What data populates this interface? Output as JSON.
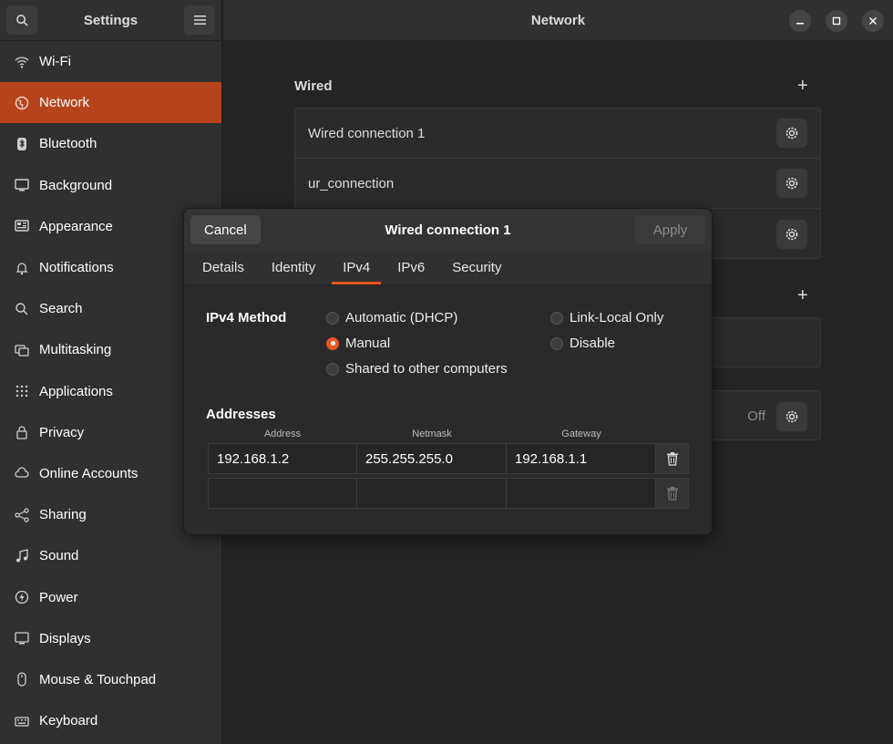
{
  "sidebar": {
    "title": "Settings",
    "items": [
      {
        "label": "Wi-Fi",
        "icon": "wifi-icon"
      },
      {
        "label": "Network",
        "icon": "network-icon",
        "active": true
      },
      {
        "label": "Bluetooth",
        "icon": "bluetooth-icon"
      },
      {
        "label": "Background",
        "icon": "background-icon"
      },
      {
        "label": "Appearance",
        "icon": "appearance-icon"
      },
      {
        "label": "Notifications",
        "icon": "bell-icon"
      },
      {
        "label": "Search",
        "icon": "search-icon"
      },
      {
        "label": "Multitasking",
        "icon": "multitasking-icon"
      },
      {
        "label": "Applications",
        "icon": "grid-icon"
      },
      {
        "label": "Privacy",
        "icon": "lock-icon"
      },
      {
        "label": "Online Accounts",
        "icon": "cloud-icon"
      },
      {
        "label": "Sharing",
        "icon": "share-icon"
      },
      {
        "label": "Sound",
        "icon": "music-note-icon"
      },
      {
        "label": "Power",
        "icon": "power-icon"
      },
      {
        "label": "Displays",
        "icon": "display-icon"
      },
      {
        "label": "Mouse & Touchpad",
        "icon": "mouse-icon"
      },
      {
        "label": "Keyboard",
        "icon": "keyboard-icon"
      }
    ]
  },
  "header": {
    "title": "Network"
  },
  "wired": {
    "title": "Wired",
    "connections": [
      "Wired connection 1",
      "ur_connection",
      ""
    ]
  },
  "vpn_row": {
    "status": "Off"
  },
  "dialog": {
    "title": "Wired connection 1",
    "cancel_label": "Cancel",
    "apply_label": "Apply",
    "tabs": [
      "Details",
      "Identity",
      "IPv4",
      "IPv6",
      "Security"
    ],
    "active_tab": "IPv4",
    "method_label": "IPv4 Method",
    "methods": {
      "auto": "Automatic (DHCP)",
      "manual": "Manual",
      "shared": "Shared to other computers",
      "link_local": "Link-Local Only",
      "disable": "Disable"
    },
    "selected_method": "Manual",
    "addresses_label": "Addresses",
    "columns": {
      "address": "Address",
      "netmask": "Netmask",
      "gateway": "Gateway"
    },
    "rows": [
      {
        "address": "192.168.1.2",
        "netmask": "255.255.255.0",
        "gateway": "192.168.1.1"
      },
      {
        "address": "",
        "netmask": "",
        "gateway": ""
      }
    ]
  },
  "colors": {
    "accent": "#e95420",
    "sidebar_active": "#b5431b",
    "background": "#242424"
  }
}
